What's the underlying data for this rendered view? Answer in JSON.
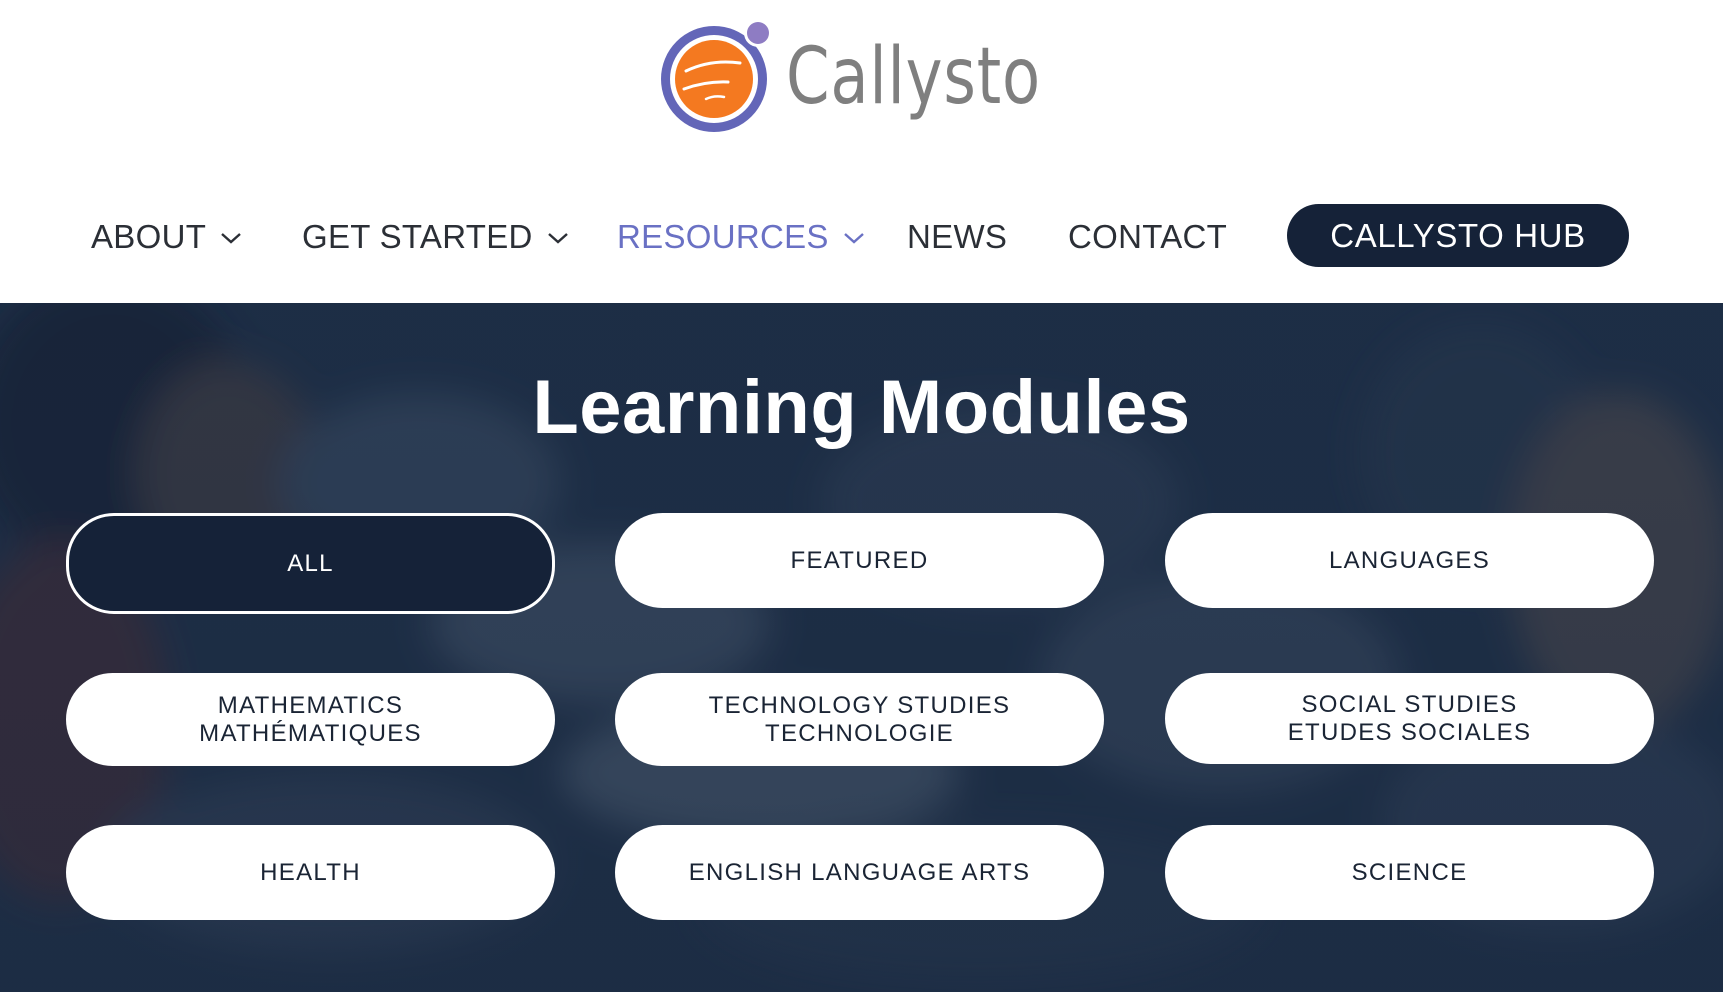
{
  "brand": {
    "name": "Callysto",
    "colors": {
      "primary_dark": "#152238",
      "accent_purple": "#6a71c4",
      "logo_orange": "#f47920",
      "logo_ring": "#6366b8",
      "logo_text": "#7f7f7f"
    }
  },
  "nav": {
    "items": [
      {
        "label": "ABOUT",
        "has_dropdown": true,
        "active": false
      },
      {
        "label": "GET STARTED",
        "has_dropdown": true,
        "active": false
      },
      {
        "label": "RESOURCES",
        "has_dropdown": true,
        "active": true
      },
      {
        "label": "NEWS",
        "has_dropdown": false,
        "active": false
      },
      {
        "label": "CONTACT",
        "has_dropdown": false,
        "active": false
      }
    ],
    "hub_button": "CALLYSTO HUB"
  },
  "hero": {
    "title": "Learning Modules",
    "filters": [
      {
        "lines": [
          "ALL"
        ],
        "selected": true
      },
      {
        "lines": [
          "FEATURED"
        ],
        "selected": false
      },
      {
        "lines": [
          "LANGUAGES"
        ],
        "selected": false
      },
      {
        "lines": [
          "MATHEMATICS",
          "MATHÉMATIQUES"
        ],
        "selected": false
      },
      {
        "lines": [
          "TECHNOLOGY STUDIES",
          "TECHNOLOGIE"
        ],
        "selected": false
      },
      {
        "lines": [
          "SOCIAL STUDIES",
          "ETUDES SOCIALES"
        ],
        "selected": false
      },
      {
        "lines": [
          "HEALTH"
        ],
        "selected": false
      },
      {
        "lines": [
          "ENGLISH LANGUAGE ARTS"
        ],
        "selected": false
      },
      {
        "lines": [
          "SCIENCE"
        ],
        "selected": false
      }
    ]
  }
}
